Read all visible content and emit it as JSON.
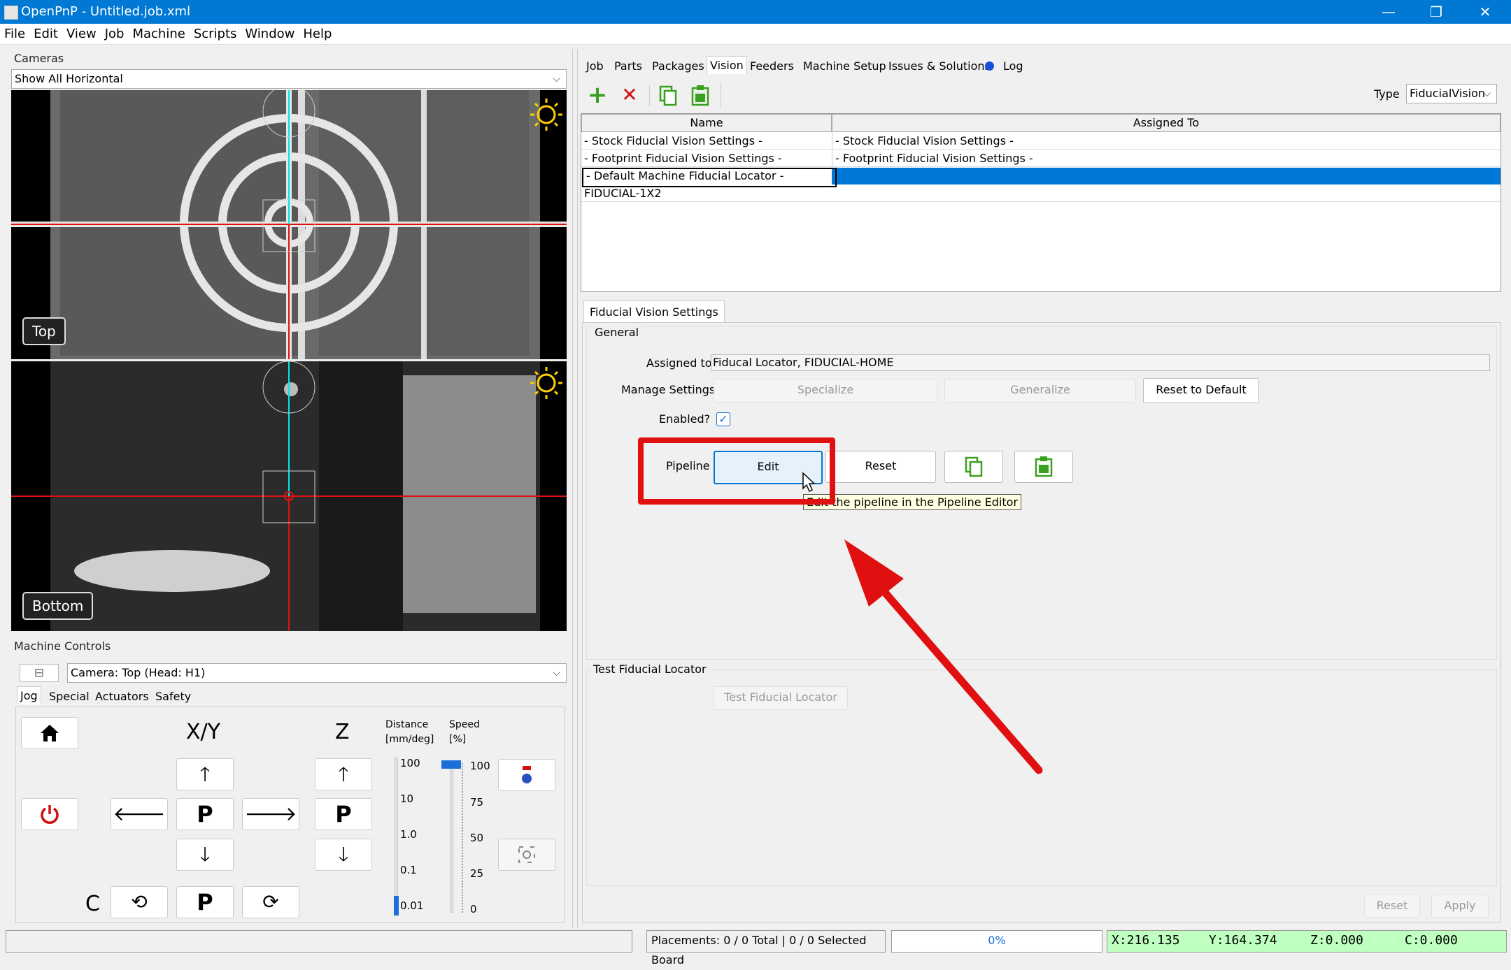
{
  "window": {
    "title": "OpenPnP - Untitled.job.xml",
    "minimize": "—",
    "restore": "❐",
    "close": "✕"
  },
  "menu": [
    "File",
    "Edit",
    "View",
    "Job",
    "Machine",
    "Scripts",
    "Window",
    "Help"
  ],
  "cameras": {
    "panel_title": "Cameras",
    "layout_select": "Show All Horizontal",
    "top_label": "Top",
    "bottom_label": "Bottom"
  },
  "machine_controls": {
    "panel_title": "Machine Controls",
    "collapse_icon": "⊟",
    "camera_select": "Camera: Top (Head: H1)",
    "tabs": [
      "Jog",
      "Special",
      "Actuators",
      "Safety"
    ],
    "xy_label": "X/Y",
    "z_label": "Z",
    "c_label": "C",
    "park_label": "P",
    "distance_label": "Distance",
    "distance_unit": "[mm/deg]",
    "speed_label": "Speed",
    "speed_unit": "[%]",
    "distance_ticks": [
      "100",
      "10",
      "1.0",
      "0.1",
      "0.01"
    ],
    "speed_ticks": [
      "100",
      "75",
      "50",
      "25",
      "0"
    ],
    "distance_value": "0.01",
    "speed_percent": 100
  },
  "main_tabs": [
    "Job",
    "Parts",
    "Packages",
    "Vision",
    "Feeders",
    "Machine Setup",
    "Issues & Solutions",
    "Log"
  ],
  "active_tab": "Vision",
  "toolbar": {
    "type_label": "Type",
    "type_value": "FiducialVision"
  },
  "table": {
    "headers": [
      "Name",
      "Assigned To"
    ],
    "rows": [
      {
        "name": "- Stock Fiducial Vision Settings -",
        "assigned": "- Stock Fiducial Vision Settings -"
      },
      {
        "name": "- Footprint Fiducial Vision Settings -",
        "assigned": "- Footprint Fiducial Vision Settings -"
      },
      {
        "name": "- Default Machine Fiducial Locator -",
        "assigned": ""
      },
      {
        "name": "FIDUCIAL-1X2",
        "assigned": ""
      }
    ]
  },
  "settings": {
    "tab": "Fiducial Vision Settings",
    "general": "General",
    "assigned_to_label": "Assigned to",
    "assigned_to_value": "Fiducal Locator, FIDUCIAL-HOME",
    "manage_label": "Manage Settings",
    "specialize": "Specialize",
    "generalize": "Generalize",
    "reset_default": "Reset to Default",
    "enabled_label": "Enabled?",
    "enabled": true,
    "pipeline_label": "Pipeline",
    "edit": "Edit",
    "reset": "Reset",
    "tooltip": "Edit the pipeline in the Pipeline Editor",
    "test_group": "Test Fiducial Locator",
    "test_button": "Test Fiducial Locator",
    "reset_btn": "Reset",
    "apply_btn": "Apply"
  },
  "statusbar": {
    "placements": "Placements: 0 / 0 Total | 0 / 0 Selected Board",
    "progress": "0%",
    "x": "X:216.135",
    "y": "Y:164.374",
    "z": "Z:0.000",
    "c": "C:0.000"
  },
  "colors": {
    "accent": "#0078d4",
    "highlight": "#0078d7",
    "annotation": "#e01010",
    "dro_bg": "#bfffbf"
  }
}
